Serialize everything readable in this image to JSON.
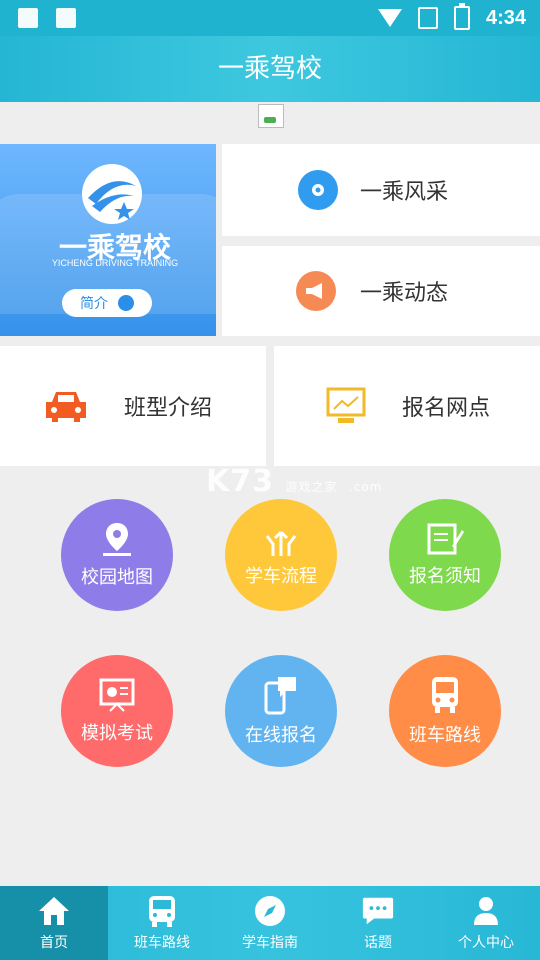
{
  "status_bar": {
    "time": "4:34",
    "icons": [
      "image-icon",
      "text-icon",
      "wifi-icon",
      "no-sim-icon",
      "battery-icon"
    ]
  },
  "header": {
    "title": "一乘驾校"
  },
  "banner": {
    "brand": "一乘驾校",
    "brand_sub": "YICHENG DRIVING TRAINING",
    "intro_button": "简介"
  },
  "cards": {
    "style": {
      "label": "一乘风采",
      "icon": "head-gear-icon",
      "color": "#2f9cf0"
    },
    "news": {
      "label": "一乘动态",
      "icon": "megaphone-icon",
      "color": "#f58a55"
    },
    "class_intro": {
      "label": "班型介绍",
      "icon": "car-icon",
      "color": "#f25c22"
    },
    "signup_points": {
      "label": "报名网点",
      "icon": "presentation-icon",
      "color": "#f2b928"
    }
  },
  "grid": [
    {
      "label": "校园地图",
      "icon": "map-pin-icon",
      "color": "#8e7ce8"
    },
    {
      "label": "学车流程",
      "icon": "branch-arrows-icon",
      "color": "#ffc83a"
    },
    {
      "label": "报名须知",
      "icon": "notepad-icon",
      "color": "#7ed94d"
    },
    {
      "label": "模拟考试",
      "icon": "screen-chart-icon",
      "color": "#ff6a6a"
    },
    {
      "label": "在线报名",
      "icon": "phone-chat-icon",
      "color": "#62b4f0"
    },
    {
      "label": "班车路线",
      "icon": "bus-icon",
      "color": "#ff8c47"
    }
  ],
  "watermark": {
    "text": "K73",
    "sub": "游戏之家",
    "domain": ".com"
  },
  "tabbar": [
    {
      "label": "首页",
      "icon": "home-icon",
      "active": true
    },
    {
      "label": "班车路线",
      "icon": "bus-icon",
      "active": false
    },
    {
      "label": "学车指南",
      "icon": "compass-icon",
      "active": false
    },
    {
      "label": "话题",
      "icon": "chat-bubble-icon",
      "active": false
    },
    {
      "label": "个人中心",
      "icon": "person-icon",
      "active": false
    }
  ]
}
